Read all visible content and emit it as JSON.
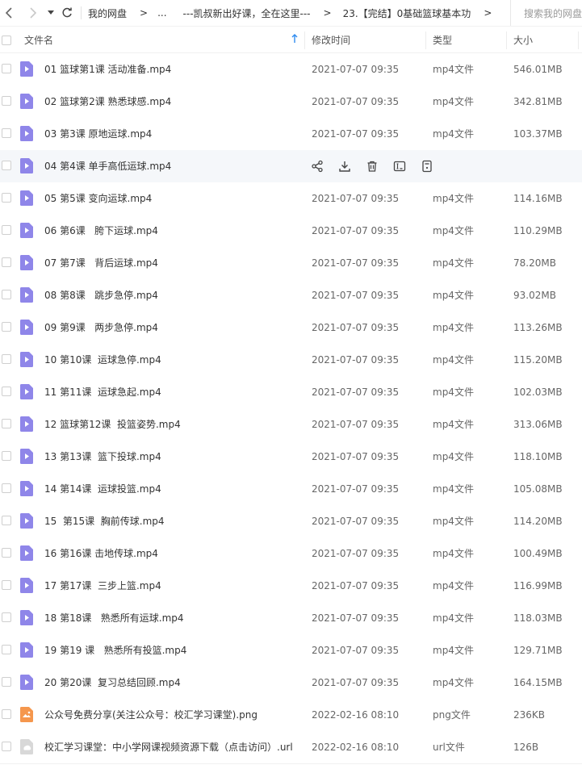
{
  "nav": {
    "breadcrumbs": [
      "我的网盘",
      "...",
      "---凯叔新出好课，全在这里---",
      "23.【完结】0基础篮球基本功"
    ],
    "search_placeholder": "搜索我的网盘"
  },
  "columns": {
    "name": "文件名",
    "time": "修改时间",
    "type": "类型",
    "size": "大小"
  },
  "files": [
    {
      "name": "01 篮球第1课 活动准备.mp4",
      "time": "2021-07-07 09:35",
      "type": "mp4文件",
      "size": "546.01MB",
      "icon": "video-file-icon"
    },
    {
      "name": "02 篮球第2课 熟悉球感.mp4",
      "time": "2021-07-07 09:35",
      "type": "mp4文件",
      "size": "342.81MB",
      "icon": "video-file-icon"
    },
    {
      "name": "03 第3课 原地运球.mp4",
      "time": "2021-07-07 09:35",
      "type": "mp4文件",
      "size": "103.37MB",
      "icon": "video-file-icon"
    },
    {
      "name": "04 第4课 单手高低运球.mp4",
      "time": "",
      "type": "",
      "size": "",
      "icon": "video-file-icon",
      "hover": true
    },
    {
      "name": "05 第5课 变向运球.mp4",
      "time": "2021-07-07 09:35",
      "type": "mp4文件",
      "size": "114.16MB",
      "icon": "video-file-icon"
    },
    {
      "name": "06 第6课   胯下运球.mp4",
      "time": "2021-07-07 09:35",
      "type": "mp4文件",
      "size": "110.29MB",
      "icon": "video-file-icon"
    },
    {
      "name": "07 第7课   背后运球.mp4",
      "time": "2021-07-07 09:35",
      "type": "mp4文件",
      "size": "78.20MB",
      "icon": "video-file-icon"
    },
    {
      "name": "08 第8课   跳步急停.mp4",
      "time": "2021-07-07 09:35",
      "type": "mp4文件",
      "size": "93.02MB",
      "icon": "video-file-icon"
    },
    {
      "name": "09 第9课   两步急停.mp4",
      "time": "2021-07-07 09:35",
      "type": "mp4文件",
      "size": "113.26MB",
      "icon": "video-file-icon"
    },
    {
      "name": "10 第10课  运球急停.mp4",
      "time": "2021-07-07 09:35",
      "type": "mp4文件",
      "size": "115.20MB",
      "icon": "video-file-icon"
    },
    {
      "name": "11 第11课  运球急起.mp4",
      "time": "2021-07-07 09:35",
      "type": "mp4文件",
      "size": "102.03MB",
      "icon": "video-file-icon"
    },
    {
      "name": "12 篮球第12课  投篮姿势.mp4",
      "time": "2021-07-07 09:35",
      "type": "mp4文件",
      "size": "313.06MB",
      "icon": "video-file-icon"
    },
    {
      "name": "13 第13课  篮下投球.mp4",
      "time": "2021-07-07 09:35",
      "type": "mp4文件",
      "size": "118.10MB",
      "icon": "video-file-icon"
    },
    {
      "name": "14 第14课  运球投篮.mp4",
      "time": "2021-07-07 09:35",
      "type": "mp4文件",
      "size": "105.08MB",
      "icon": "video-file-icon"
    },
    {
      "name": "15  第15课  胸前传球.mp4",
      "time": "2021-07-07 09:35",
      "type": "mp4文件",
      "size": "114.20MB",
      "icon": "video-file-icon"
    },
    {
      "name": "16 第16课 击地传球.mp4",
      "time": "2021-07-07 09:35",
      "type": "mp4文件",
      "size": "100.49MB",
      "icon": "video-file-icon"
    },
    {
      "name": "17 第17课  三步上篮.mp4",
      "time": "2021-07-07 09:35",
      "type": "mp4文件",
      "size": "116.99MB",
      "icon": "video-file-icon"
    },
    {
      "name": "18 第18课   熟悉所有运球.mp4",
      "time": "2021-07-07 09:35",
      "type": "mp4文件",
      "size": "118.03MB",
      "icon": "video-file-icon"
    },
    {
      "name": "19 第19 课   熟悉所有投篮.mp4",
      "time": "2021-07-07 09:35",
      "type": "mp4文件",
      "size": "129.71MB",
      "icon": "video-file-icon"
    },
    {
      "name": "20 第20课  复习总结回顾.mp4",
      "time": "2021-07-07 09:35",
      "type": "mp4文件",
      "size": "164.15MB",
      "icon": "video-file-icon"
    },
    {
      "name": "公众号免费分享(关注公众号：校汇学习课堂).png",
      "time": "2022-02-16 08:10",
      "type": "png文件",
      "size": "236KB",
      "icon": "image-file-icon"
    },
    {
      "name": "校汇学习课堂：中小学网课视频资源下载（点击访问）.url",
      "time": "2022-02-16 08:10",
      "type": "url文件",
      "size": "126B",
      "icon": "link-file-icon"
    }
  ],
  "hover_actions": [
    "share-icon",
    "download-icon",
    "delete-icon",
    "rename-icon",
    "more-icon"
  ],
  "colors": {
    "video_icon": "#8f86e9",
    "image_icon": "#f5974d",
    "link_icon": "#d8d8d8",
    "sort_arrow": "#2e8bf0",
    "hover_row": "#f5f7fa"
  }
}
